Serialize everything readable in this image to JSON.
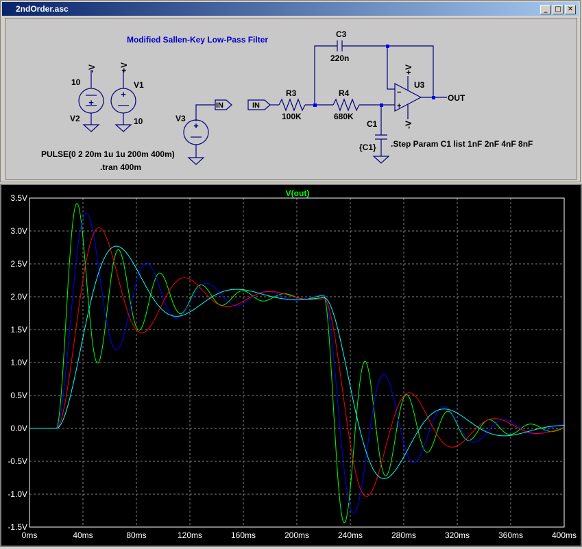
{
  "window": {
    "title": "2ndOrder.asc",
    "buttons": {
      "minimize": "_",
      "maximize": "□",
      "close": "✕"
    }
  },
  "schematic": {
    "title_text": "Modified Sallen-Key Low-Pass Filter",
    "pulse_text": "PULSE(0 2 20m 1u 1u 200m 400m)",
    "tran_text": ".tran 400m",
    "step_text": ".Step Param C1 list 1nF 2nF 4nF 8nF",
    "components": {
      "v2": {
        "name": "V2",
        "value": "10",
        "top_label": "-V"
      },
      "v1": {
        "name": "V1",
        "value": "10",
        "top_label": "+V"
      },
      "v3": {
        "name": "V3"
      },
      "r3": {
        "name": "R3",
        "value": "100K"
      },
      "r4": {
        "name": "R4",
        "value": "680K"
      },
      "c3": {
        "name": "C3",
        "value": "220n"
      },
      "c1": {
        "name": "C1",
        "value": "{C1}"
      },
      "u3": {
        "name": "U3",
        "plus": "+V",
        "minus": "-V"
      }
    },
    "labels": {
      "in_flag_out": "IN",
      "in_flag_in": "IN",
      "out_label": "OUT"
    },
    "colors": {
      "text": "#000000",
      "title": "#0000c8",
      "wire": "#000080",
      "component": "#000080",
      "junction": "#0000ff"
    }
  },
  "chart_data": {
    "type": "line",
    "title": "V(out)",
    "xlabel": "",
    "ylabel": "",
    "xlim": [
      0,
      400
    ],
    "ylim": [
      -1.5,
      3.5
    ],
    "x_unit": "ms",
    "x_ticks": [
      "0ms",
      "40ms",
      "80ms",
      "120ms",
      "160ms",
      "200ms",
      "240ms",
      "280ms",
      "320ms",
      "360ms",
      "400ms"
    ],
    "y_ticks": [
      "3.5V",
      "3.0V",
      "2.5V",
      "2.0V",
      "1.5V",
      "1.0V",
      "0.5V",
      "0.0V",
      "-0.5V",
      "-1.0V",
      "-1.5V"
    ],
    "y_tick_values": [
      3.5,
      3.0,
      2.5,
      2.0,
      1.5,
      1.0,
      0.5,
      0.0,
      -0.5,
      -1.0,
      -1.5
    ],
    "grid": true,
    "step_times": [
      20,
      220
    ],
    "step_amplitudes": [
      2,
      -2
    ],
    "series": [
      {
        "color": "#00ff00",
        "peak": 3.42,
        "peak_time": 35.5,
        "min": -1.45,
        "min_time": 235.5
      },
      {
        "color": "#0000ff",
        "peak": 3.27,
        "peak_time": 42.5,
        "min": -1.27,
        "min_time": 242.5
      },
      {
        "color": "#ff0000",
        "peak": 3.05,
        "peak_time": 52.0,
        "min": -1.05,
        "min_time": 252.0
      },
      {
        "color": "#00ffff",
        "peak": 2.77,
        "peak_time": 65.0,
        "min": -0.77,
        "min_time": 265.0
      }
    ],
    "colors": {
      "background": "#000000",
      "grid": "#808080",
      "title": "#00ff00",
      "tick_text": "#ffffff",
      "frame": "#ffffff"
    }
  }
}
